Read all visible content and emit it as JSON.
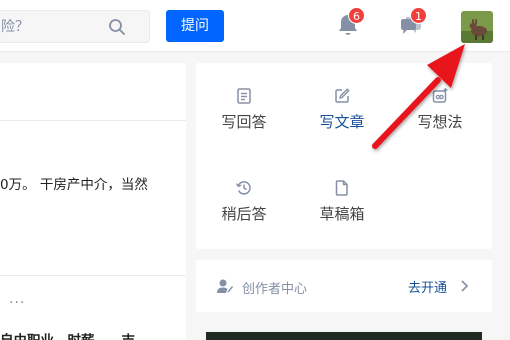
{
  "header": {
    "search": {
      "placeholder": "险？"
    },
    "ask_label": "提问",
    "notifications": {
      "count": "6"
    },
    "messages": {
      "count": "1"
    }
  },
  "feed": {
    "lines": [
      "0万。 干房产中介，当然",
      "自由职业，时薪……吉"
    ],
    "more": "···"
  },
  "creation": {
    "items": [
      {
        "label": "写回答",
        "icon": "answer-icon"
      },
      {
        "label": "写文章",
        "icon": "edit-icon"
      },
      {
        "label": "写想法",
        "icon": "idea-icon"
      },
      {
        "label": "稍后答",
        "icon": "history-icon"
      },
      {
        "label": "草稿箱",
        "icon": "draft-icon"
      }
    ]
  },
  "creator_center": {
    "label": "创作者中心",
    "action": "去开通"
  },
  "colors": {
    "brand": "#0066ff",
    "link": "#175199",
    "badge": "#f1403c",
    "annotation_arrow": "#e8141b"
  }
}
